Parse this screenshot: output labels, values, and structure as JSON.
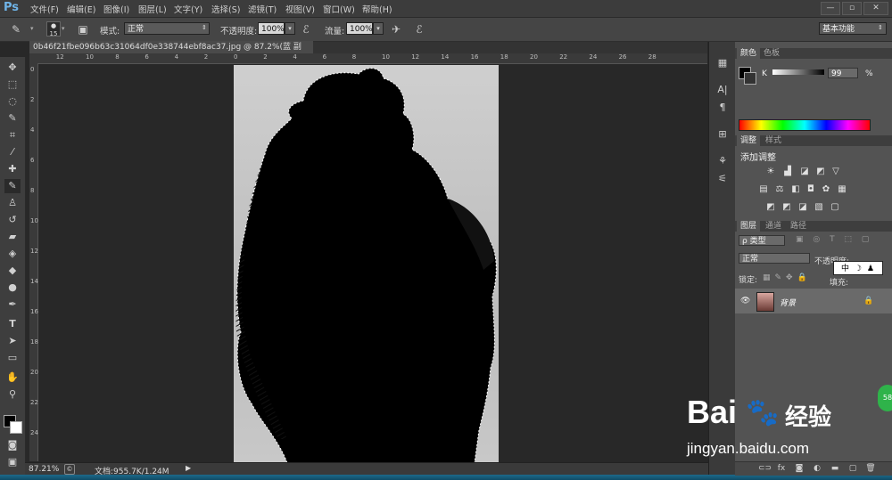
{
  "app": {
    "logo": "Ps"
  },
  "menu": [
    "文件(F)",
    "编辑(E)",
    "图像(I)",
    "图层(L)",
    "文字(Y)",
    "选择(S)",
    "滤镜(T)",
    "视图(V)",
    "窗口(W)",
    "帮助(H)"
  ],
  "options": {
    "brush_size": "15",
    "mode_label": "模式:",
    "mode_value": "正常",
    "opacity_label": "不透明度:",
    "opacity_value": "100%",
    "flow_label": "流量:",
    "flow_value": "100%",
    "workspace": "基本功能"
  },
  "document": {
    "tab_title": "0b46f21fbe096b63c31064df0e338744ebf8ac37.jpg @ 87.2%(蓝 副本/8) *"
  },
  "rulers": {
    "top": [
      "12",
      "10",
      "8",
      "6",
      "4",
      "2",
      "0",
      "2",
      "4",
      "6",
      "8",
      "10",
      "12",
      "14",
      "16",
      "18",
      "20",
      "22",
      "24",
      "26",
      "28"
    ],
    "left": [
      "0",
      "2",
      "4",
      "6",
      "8",
      "10",
      "12",
      "14",
      "16",
      "18",
      "20",
      "22",
      "24"
    ]
  },
  "status": {
    "zoom": "87.21%",
    "doc_info": "文档:955.7K/1.24M"
  },
  "color_panel": {
    "tab_color": "颜色",
    "tab_swatches": "色板",
    "channel": "K",
    "value": "99",
    "unit": "%"
  },
  "adjust_panel": {
    "tab_adjust": "调整",
    "tab_styles": "样式",
    "heading": "添加调整"
  },
  "layers_panel": {
    "tab_layers": "图层",
    "tab_channels": "通道",
    "tab_paths": "路径",
    "kind_label": "ρ 类型",
    "blend_mode": "正常",
    "opacity_label": "不透明度:",
    "lock_label": "锁定:",
    "fill_label": "填充:",
    "ime": "中",
    "layer_name": "背景"
  },
  "watermark": {
    "brand": "Bai",
    "brand2": "经验",
    "url": "jingyan.baidu.com",
    "badge": "58"
  },
  "colors": {
    "accent": "#6fb4e8",
    "selection": "#ffffff"
  }
}
